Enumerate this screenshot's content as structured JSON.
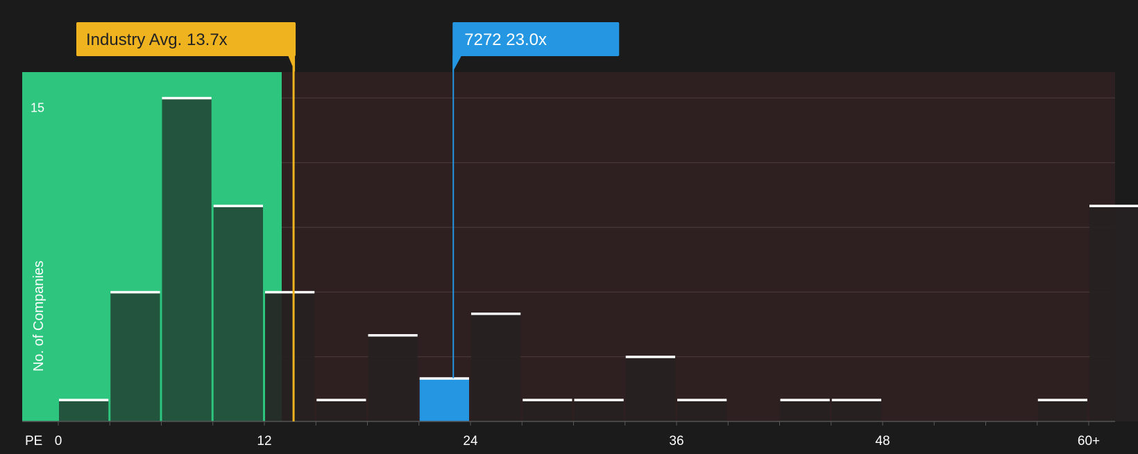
{
  "chart_data": {
    "type": "bar",
    "x_axis_label": "PE",
    "y_axis_label": "No. of Companies",
    "x_ticks": [
      "0",
      "12",
      "24",
      "36",
      "48",
      "60+"
    ],
    "y_ticks": [
      "15"
    ],
    "ylim": [
      0,
      16.2
    ],
    "bin_width": 3,
    "grid": true,
    "bins": [
      {
        "start": 0,
        "end": 3,
        "count": 1
      },
      {
        "start": 3,
        "end": 6,
        "count": 6
      },
      {
        "start": 6,
        "end": 9,
        "count": 15
      },
      {
        "start": 9,
        "end": 12,
        "count": 10
      },
      {
        "start": 12,
        "end": 15,
        "count": 6
      },
      {
        "start": 15,
        "end": 18,
        "count": 1
      },
      {
        "start": 18,
        "end": 21,
        "count": 4
      },
      {
        "start": 21,
        "end": 24,
        "count": 2,
        "highlighted": true
      },
      {
        "start": 24,
        "end": 27,
        "count": 5
      },
      {
        "start": 27,
        "end": 30,
        "count": 1
      },
      {
        "start": 30,
        "end": 33,
        "count": 1
      },
      {
        "start": 33,
        "end": 36,
        "count": 3
      },
      {
        "start": 36,
        "end": 39,
        "count": 1
      },
      {
        "start": 39,
        "end": 42,
        "count": 0
      },
      {
        "start": 42,
        "end": 45,
        "count": 1
      },
      {
        "start": 45,
        "end": 48,
        "count": 1
      },
      {
        "start": 48,
        "end": 51,
        "count": 0
      },
      {
        "start": 51,
        "end": 54,
        "count": 0
      },
      {
        "start": 54,
        "end": 57,
        "count": 0
      },
      {
        "start": 57,
        "end": 60,
        "count": 1
      },
      {
        "start": 60,
        "end": 63,
        "count": 10
      }
    ],
    "industry_average": {
      "label": "Industry Avg. 13.7x",
      "value": 13.7
    },
    "company": {
      "label": "7272 23.0x",
      "value": 23.0
    },
    "colors": {
      "background": "#1b1b1c",
      "good_region": "#2ec67e",
      "bad_region": "#2e1f20",
      "bar_in_good": "#234a38",
      "bar_in_bad": "#262122",
      "company_bar": "#2496e2",
      "industry_marker": "#f0b320",
      "company_marker": "#2496e2",
      "bar_cap": "#ffffff",
      "grid": "#4a3a3b"
    }
  }
}
